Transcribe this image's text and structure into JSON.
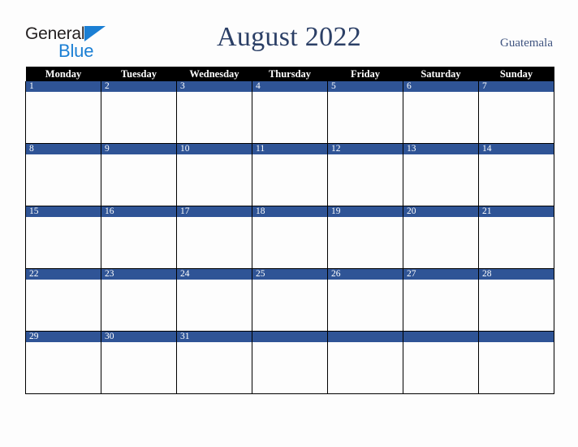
{
  "brand": {
    "name_part1": "General",
    "name_part2": "Blue",
    "triangle_icon": "triangle-icon",
    "colors": {
      "dark": "#231f20",
      "blue": "#1b7fd4"
    }
  },
  "header": {
    "title": "August 2022",
    "country": "Guatemala"
  },
  "colors": {
    "page_background": "#fdfdfd",
    "header_row_background": "#000000",
    "header_row_text": "#ffffff",
    "date_bar_background": "#2f5496",
    "date_bar_text": "#ffffff",
    "cell_background": "#fdfdfd",
    "grid_line": "#000000",
    "title_text": "#2b3f66",
    "country_text": "#3f5480"
  },
  "calendar": {
    "month": "August",
    "year": "2022",
    "weekday_headers": [
      "Monday",
      "Tuesday",
      "Wednesday",
      "Thursday",
      "Friday",
      "Saturday",
      "Sunday"
    ],
    "weeks": [
      {
        "index": 0,
        "days": [
          {
            "date": "1"
          },
          {
            "date": "2"
          },
          {
            "date": "3"
          },
          {
            "date": "4"
          },
          {
            "date": "5"
          },
          {
            "date": "6"
          },
          {
            "date": "7"
          }
        ]
      },
      {
        "index": 1,
        "days": [
          {
            "date": "8"
          },
          {
            "date": "9"
          },
          {
            "date": "10"
          },
          {
            "date": "11"
          },
          {
            "date": "12"
          },
          {
            "date": "13"
          },
          {
            "date": "14"
          }
        ]
      },
      {
        "index": 2,
        "days": [
          {
            "date": "15"
          },
          {
            "date": "16"
          },
          {
            "date": "17"
          },
          {
            "date": "18"
          },
          {
            "date": "19"
          },
          {
            "date": "20"
          },
          {
            "date": "21"
          }
        ]
      },
      {
        "index": 3,
        "days": [
          {
            "date": "22"
          },
          {
            "date": "23"
          },
          {
            "date": "24"
          },
          {
            "date": "25"
          },
          {
            "date": "26"
          },
          {
            "date": "27"
          },
          {
            "date": "28"
          }
        ]
      },
      {
        "index": 4,
        "days": [
          {
            "date": "29"
          },
          {
            "date": "30"
          },
          {
            "date": "31"
          },
          {
            "date": ""
          },
          {
            "date": ""
          },
          {
            "date": ""
          },
          {
            "date": ""
          }
        ]
      }
    ]
  }
}
